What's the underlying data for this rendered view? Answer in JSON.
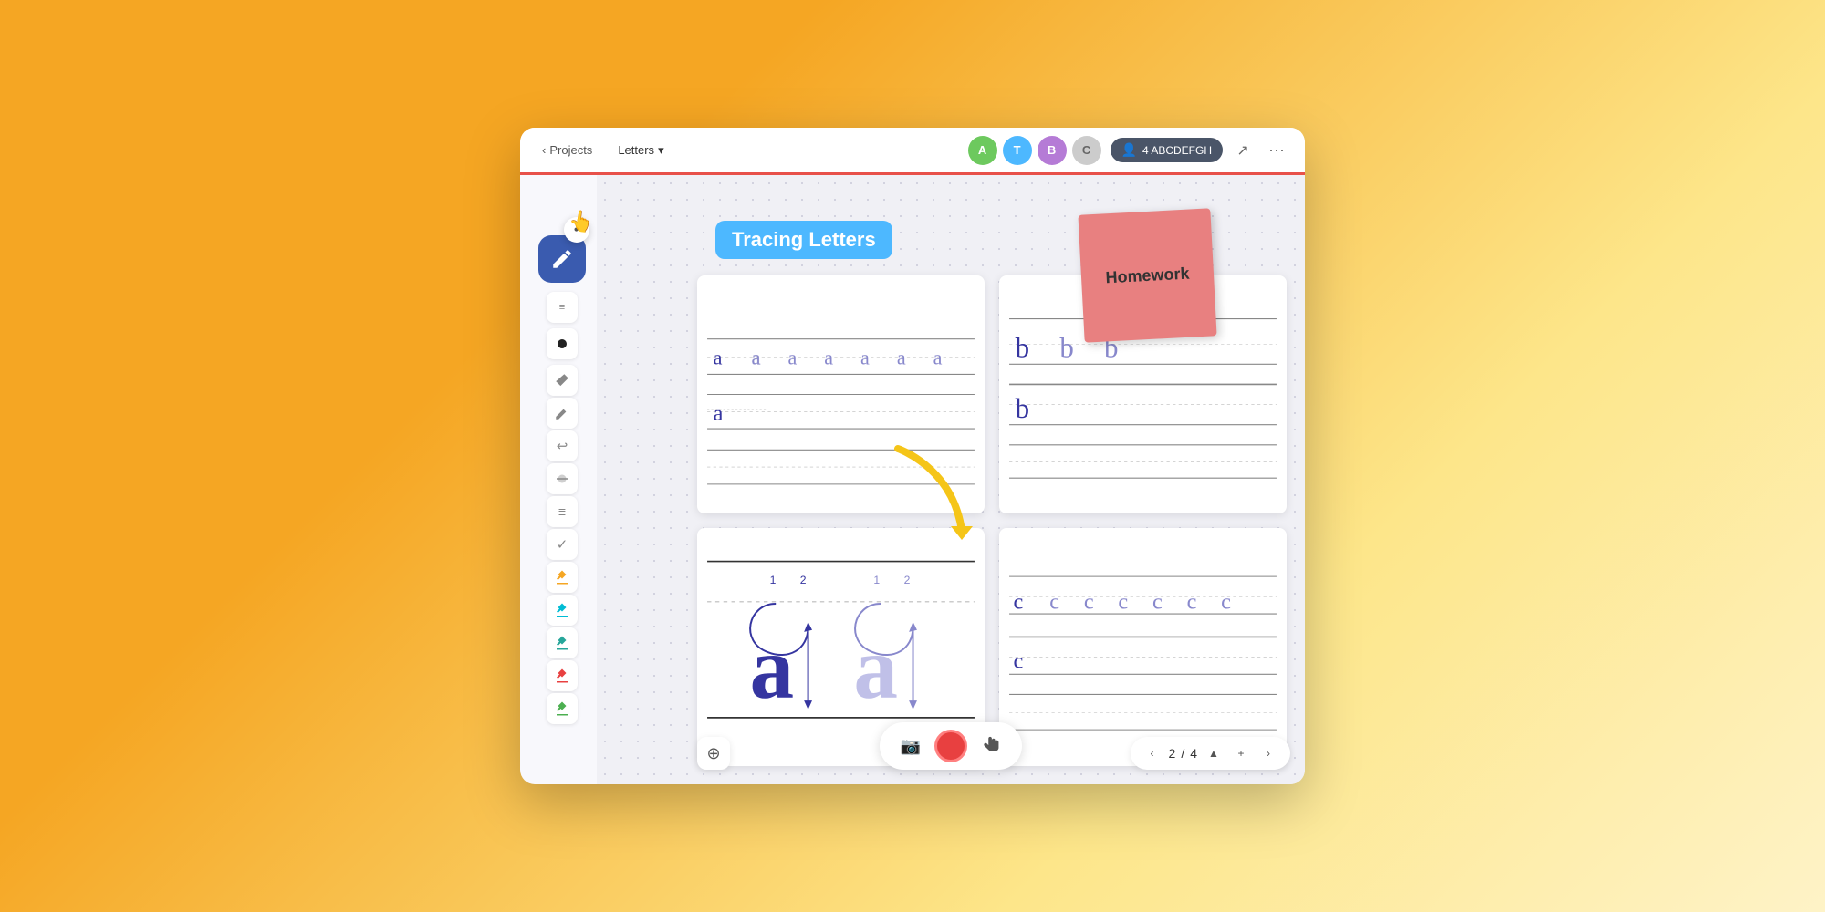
{
  "window": {
    "title": "Tracing Letters"
  },
  "topbar": {
    "back_label": "Projects",
    "current_label": "Letters",
    "dropdown_arrow": "▾",
    "share_label": "4 ABCDEFGH",
    "dots": "···"
  },
  "avatars": [
    {
      "id": "a1",
      "letter": "A",
      "color": "#6dc95e"
    },
    {
      "id": "a2",
      "letter": "T",
      "color": "#4db8ff"
    },
    {
      "id": "a3",
      "letter": "B",
      "color": "#b57bd6"
    },
    {
      "id": "a4",
      "letter": "C",
      "color": "#cccccc"
    }
  ],
  "canvas": {
    "title_badge": "Tracing Letters",
    "sticky_note_text": "Homework"
  },
  "toolbar": {
    "tools": [
      {
        "name": "pen",
        "label": "✏"
      },
      {
        "name": "eraser",
        "label": "◻"
      },
      {
        "name": "undo",
        "label": "↩"
      },
      {
        "name": "notes",
        "label": "≡"
      },
      {
        "name": "lines",
        "label": "≡"
      },
      {
        "name": "check",
        "label": "✓"
      }
    ],
    "color_tools": [
      {
        "name": "orange",
        "label": "🔶"
      },
      {
        "name": "cyan",
        "label": "💧"
      },
      {
        "name": "teal",
        "label": "🖊"
      },
      {
        "name": "red",
        "label": "🔴"
      },
      {
        "name": "green",
        "label": "🟢"
      }
    ]
  },
  "bottom_controls": {
    "camera_icon": "📷",
    "record_label": "",
    "hand_icon": "✋"
  },
  "pagination": {
    "current": "2",
    "total": "4",
    "separator": "/",
    "prev": "‹",
    "up": "▲",
    "plus": "+",
    "next": "›"
  },
  "zoom": {
    "icon": "⊕"
  }
}
